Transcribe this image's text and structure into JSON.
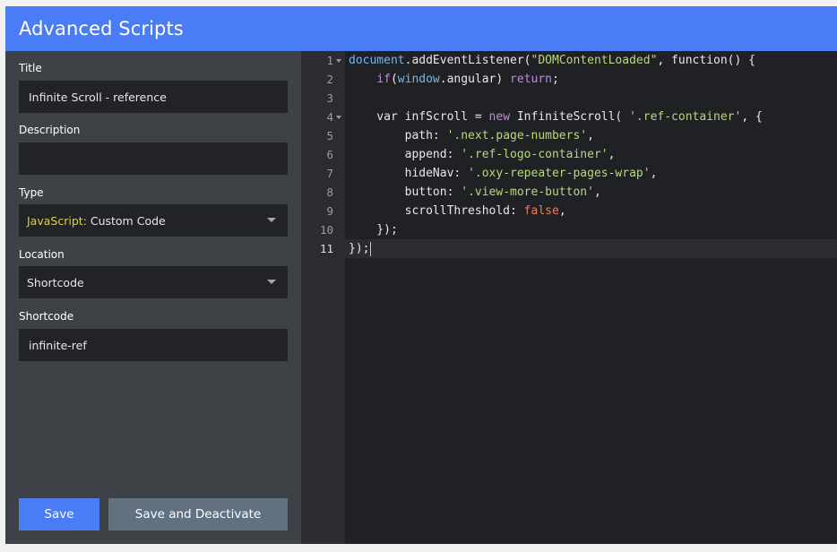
{
  "header": {
    "title": "Advanced Scripts"
  },
  "form": {
    "title_label": "Title",
    "title_value": "Infinite Scroll - reference",
    "description_label": "Description",
    "description_value": "",
    "type_label": "Type",
    "type_value_lang": "JavaScript:",
    "type_value_rest": " Custom Code",
    "location_label": "Location",
    "location_value": "Shortcode",
    "shortcode_label": "Shortcode",
    "shortcode_value": "infinite-ref"
  },
  "buttons": {
    "save": "Save",
    "save_deactivate": "Save and Deactivate"
  },
  "editor": {
    "active_line": 11,
    "lines": [
      {
        "n": 1,
        "fold": true,
        "tokens": [
          [
            "var",
            "document"
          ],
          [
            "def",
            ".addEventListener("
          ],
          [
            "str",
            "\"DOMContentLoaded\""
          ],
          [
            "def",
            ", function() {"
          ]
        ]
      },
      {
        "n": 2,
        "fold": false,
        "tokens": [
          [
            "def",
            "    "
          ],
          [
            "kw",
            "if"
          ],
          [
            "def",
            "("
          ],
          [
            "var",
            "window"
          ],
          [
            "def",
            ".angular) "
          ],
          [
            "kw",
            "return"
          ],
          [
            "def",
            ";"
          ]
        ]
      },
      {
        "n": 3,
        "fold": false,
        "tokens": []
      },
      {
        "n": 4,
        "fold": true,
        "tokens": [
          [
            "def",
            "    var infScroll = "
          ],
          [
            "kw",
            "new"
          ],
          [
            "def",
            " InfiniteScroll( "
          ],
          [
            "str",
            "'.ref-container'"
          ],
          [
            "def",
            ", {"
          ]
        ]
      },
      {
        "n": 5,
        "fold": false,
        "tokens": [
          [
            "def",
            "        path: "
          ],
          [
            "str",
            "'.next.page-numbers'"
          ],
          [
            "def",
            ","
          ]
        ]
      },
      {
        "n": 6,
        "fold": false,
        "tokens": [
          [
            "def",
            "        append: "
          ],
          [
            "str",
            "'.ref-logo-container'"
          ],
          [
            "def",
            ","
          ]
        ]
      },
      {
        "n": 7,
        "fold": false,
        "tokens": [
          [
            "def",
            "        hideNav: "
          ],
          [
            "str",
            "'.oxy-repeater-pages-wrap'"
          ],
          [
            "def",
            ","
          ]
        ]
      },
      {
        "n": 8,
        "fold": false,
        "tokens": [
          [
            "def",
            "        button: "
          ],
          [
            "str",
            "'.view-more-button'"
          ],
          [
            "def",
            ","
          ]
        ]
      },
      {
        "n": 9,
        "fold": false,
        "tokens": [
          [
            "def",
            "        scrollThreshold: "
          ],
          [
            "bool",
            "false"
          ],
          [
            "def",
            ","
          ]
        ]
      },
      {
        "n": 10,
        "fold": false,
        "tokens": [
          [
            "def",
            "    });"
          ]
        ]
      },
      {
        "n": 11,
        "fold": false,
        "tokens": [
          [
            "def",
            "});"
          ]
        ]
      }
    ]
  },
  "colors": {
    "accent": "#4a7cf6",
    "panel": "#3e4247",
    "input_bg": "#212327",
    "editor_bg": "#1f2124",
    "secondary_button": "#617180"
  }
}
